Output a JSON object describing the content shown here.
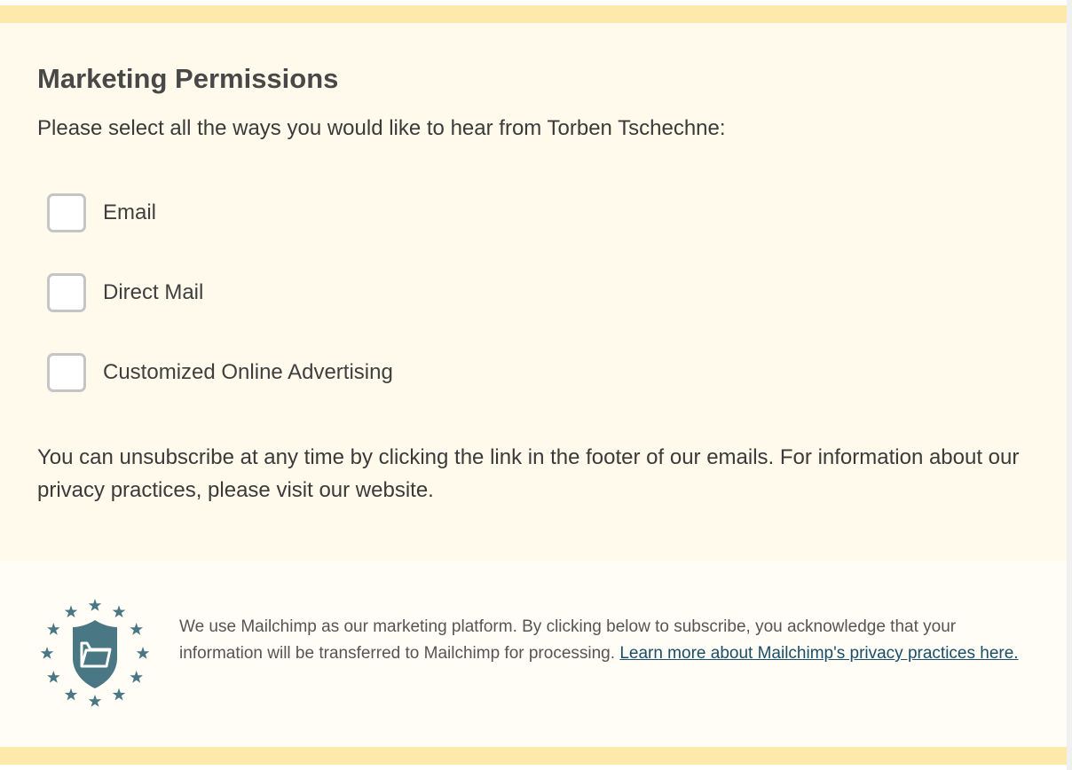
{
  "permissions": {
    "title": "Marketing Permissions",
    "intro": "Please select all the ways you would like to hear from Torben Tschechne:",
    "options": [
      {
        "label": "Email",
        "checked": false
      },
      {
        "label": "Direct Mail",
        "checked": false
      },
      {
        "label": "Customized Online Advertising",
        "checked": false
      }
    ],
    "unsubscribe_note": "You can unsubscribe at any time by clicking the link in the footer of our emails. For information about our privacy practices, please visit our website."
  },
  "footer": {
    "badge_icon": "gdpr-shield-folder-icon",
    "text": "We use Mailchimp as our marketing platform. By clicking below to subscribe, you acknowledge that your information will be transferred to Mailchimp for processing.",
    "link_text": "Learn more about Mailchimp's privacy practices here."
  },
  "colors": {
    "band": "#fde9a9",
    "panel_background": "#fffaeb",
    "footer_background": "#fffdf5",
    "badge": "#4a7784",
    "link": "#1a4d68"
  }
}
